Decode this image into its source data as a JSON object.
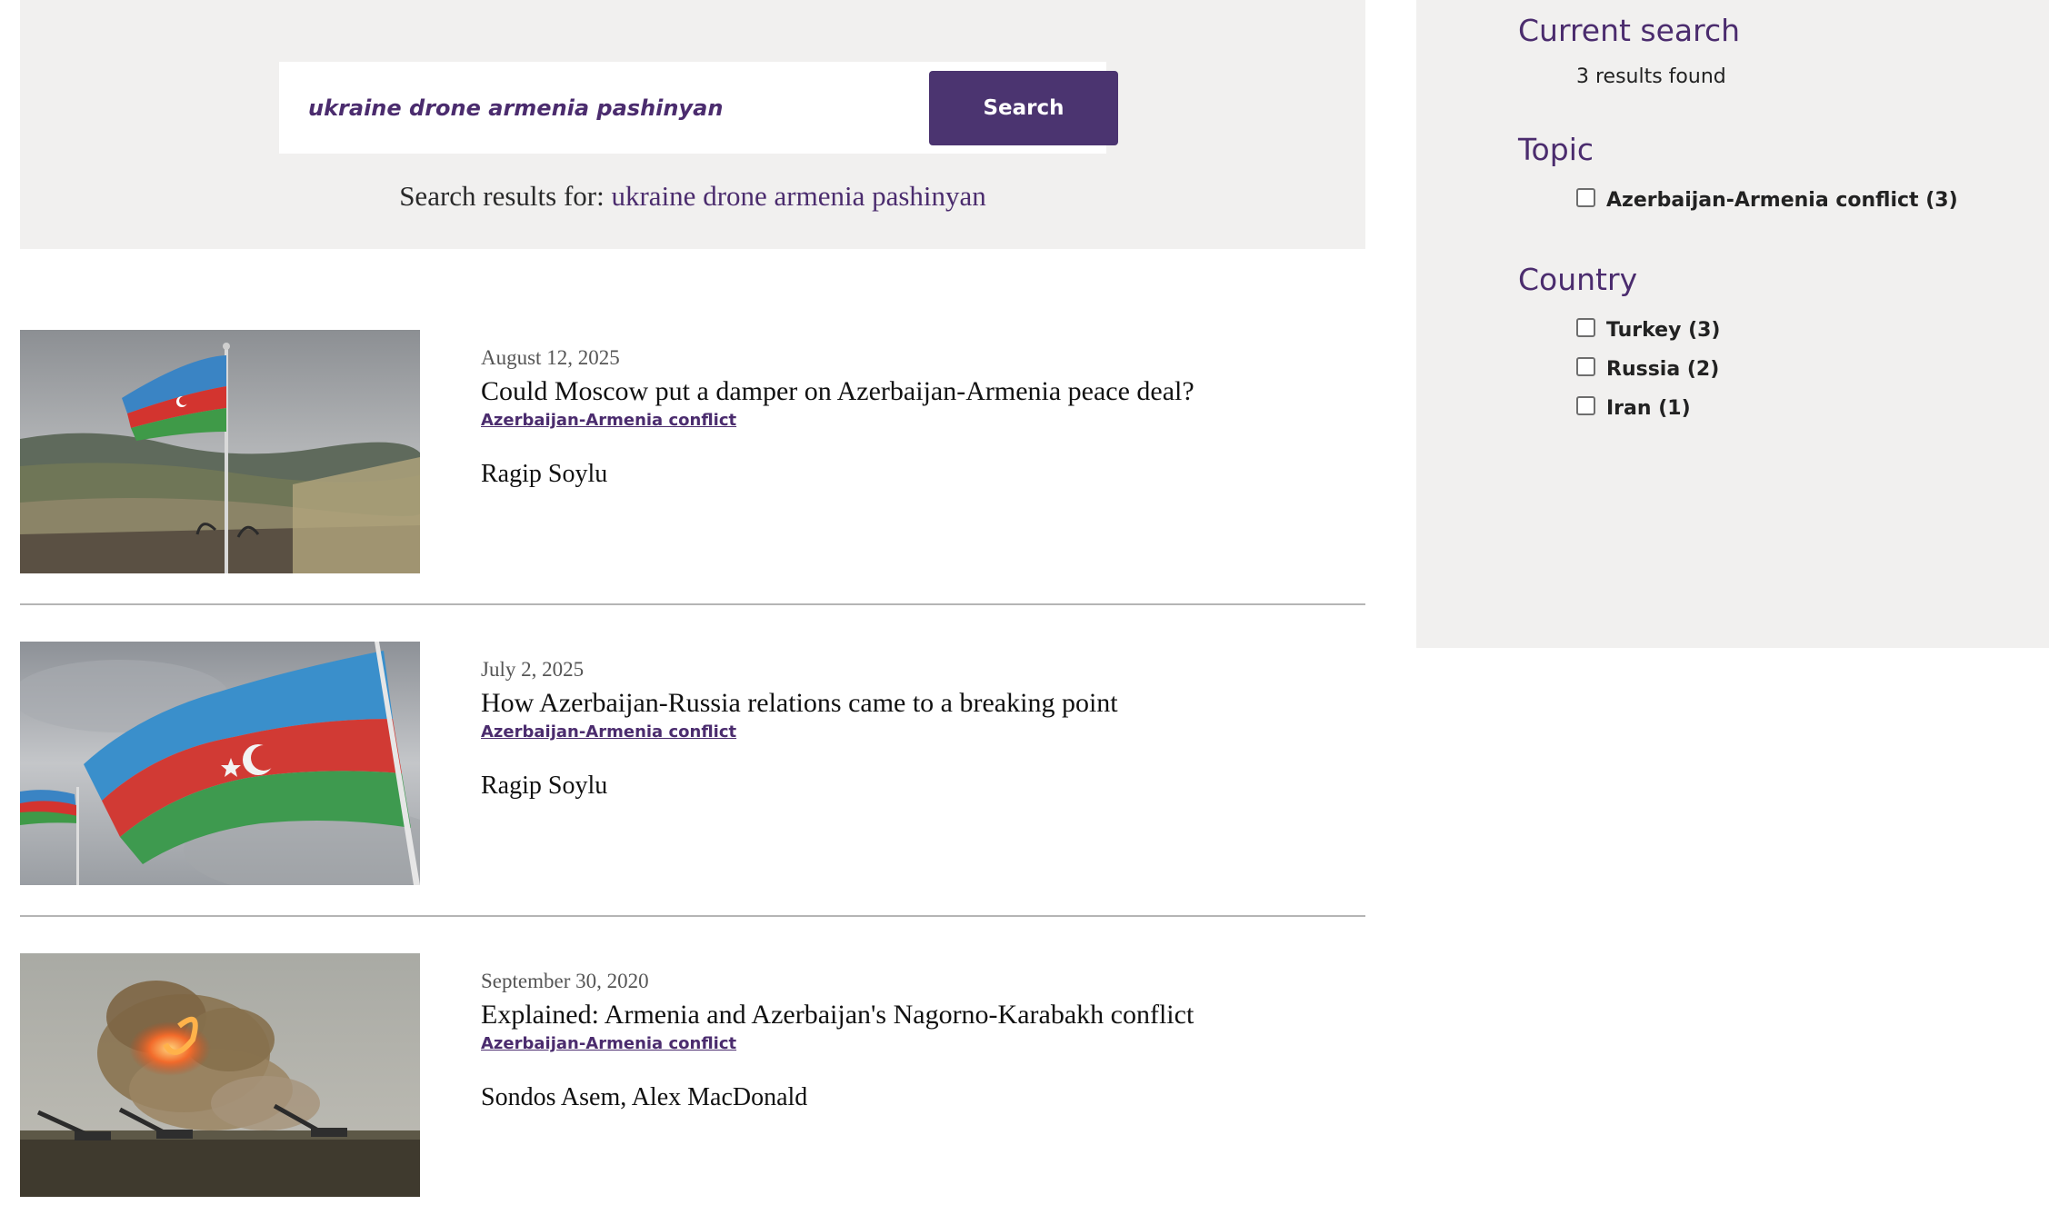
{
  "search": {
    "value": "ukraine drone armenia pashinyan",
    "button_label": "Search",
    "results_prefix": "Search results for: ",
    "query": "ukraine drone armenia pashinyan"
  },
  "results": [
    {
      "date": "August 12, 2025",
      "title": "Could Moscow put a damper on Azerbaijan-Armenia peace deal?",
      "topic": "Azerbaijan-Armenia conflict",
      "author": "Ragip Soylu",
      "image": "azerbaijan-flag-on-pole-landscape"
    },
    {
      "date": "July 2, 2025",
      "title": "How Azerbaijan-Russia relations came to a breaking point",
      "topic": "Azerbaijan-Armenia conflict",
      "author": "Ragip Soylu",
      "image": "azerbaijan-flag-waving-closeup"
    },
    {
      "date": "September 30, 2020",
      "title": "Explained: Armenia and Azerbaijan's Nagorno-Karabakh conflict",
      "topic": "Azerbaijan-Armenia conflict",
      "author": "Sondos Asem, Alex MacDonald",
      "image": "artillery-fire-smoke-field"
    }
  ],
  "sidebar": {
    "current_search": {
      "heading": "Current search",
      "summary": "3 results found"
    },
    "topic": {
      "heading": "Topic",
      "options": [
        "Azerbaijan-Armenia conflict (3)"
      ]
    },
    "country": {
      "heading": "Country",
      "options": [
        "Turkey (3)",
        "Russia (2)",
        "Iran (1)"
      ]
    }
  },
  "colors": {
    "brand": "#4b2c6e",
    "button": "#4b3470",
    "panel_bg": "#f1f0ef"
  }
}
